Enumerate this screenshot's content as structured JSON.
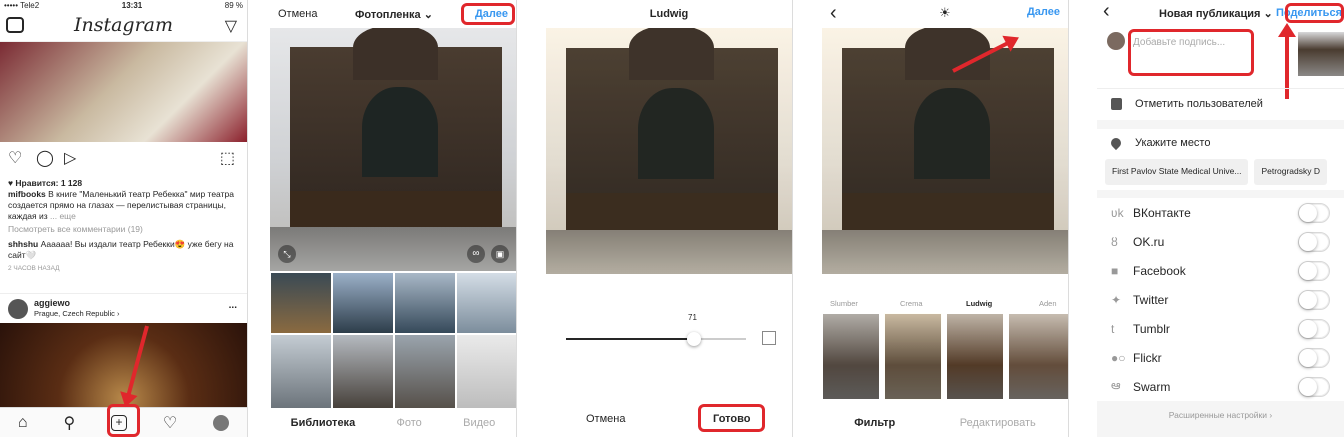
{
  "panel1": {
    "carrier": "••••• Tele2",
    "wifi_icon": "wifi-icon",
    "time": "13:31",
    "battery": "89 %",
    "logo": "Instagram",
    "likes": "♥ Нравится: 1 128",
    "caption_user": "mifbooks",
    "caption_text": " В книге \"Маленький театр Ребекка\" мир театра создается прямо на глазах — перелистывая страницы, каждая из",
    "caption_more": "... еще",
    "view_comments": "Посмотреть все комментарии (19)",
    "comment_user": "shhshu",
    "comment_text": " Аааааа! Вы издали театр Ребекки😍 уже бегу на сайт🤍",
    "time_ago": "2 ЧАСОВ НАЗАД",
    "next_user": "aggiewo",
    "next_location": "Prague, Czech Republic ›",
    "more_dots": "..."
  },
  "panel2": {
    "cancel": "Отмена",
    "album": "Фотопленка ⌄",
    "next": "Далее",
    "tabs": [
      "Библиотека",
      "Фото",
      "Видео"
    ]
  },
  "panel3": {
    "title": "Ludwig",
    "slider_value": "71",
    "slider_fraction": 0.71,
    "cancel": "Отмена",
    "done": "Готово"
  },
  "panel4": {
    "back": "‹",
    "next": "Далее",
    "filters": [
      "Slumber",
      "Crema",
      "Ludwig",
      "Aden"
    ],
    "tabs": [
      "Фильтр",
      "Редактировать"
    ]
  },
  "panel5": {
    "back": "‹",
    "title": "Новая публикация ⌄",
    "share": "Поделиться",
    "caption_placeholder": "Добавьте подпись...",
    "tag_people": "Отметить пользователей",
    "add_location": "Укажите место",
    "location_chips": [
      "First Pavlov State Medical Unive...",
      "Petrogradsky D"
    ],
    "networks": [
      "ВКонтакте",
      "OK.ru",
      "Facebook",
      "Twitter",
      "Tumblr",
      "Flickr",
      "Swarm"
    ],
    "network_icons": [
      "vk-icon",
      "ok-icon",
      "facebook-icon",
      "twitter-icon",
      "tumblr-icon",
      "flickr-icon",
      "swarm-icon"
    ],
    "advanced": "Расширенные настройки ›"
  },
  "colors": {
    "accent": "#3897f0",
    "annotation": "#e0272c"
  }
}
